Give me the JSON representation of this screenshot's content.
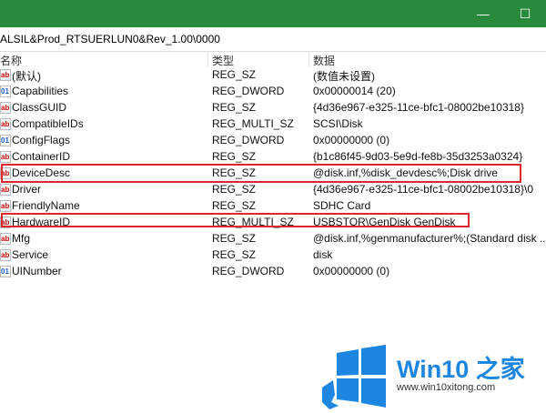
{
  "window": {
    "controls": {
      "minimize": "—",
      "maximize": "☐",
      "close": "✕"
    }
  },
  "path": "ALSIL&Prod_RTSUERLUN0&Rev_1.00\\0000",
  "columns": {
    "name": "名称",
    "type": "类型",
    "data": "数据"
  },
  "rows": [
    {
      "name": "(默认)",
      "type": "REG_SZ",
      "data": "(数值未设置)",
      "icon": "ab"
    },
    {
      "name": "Capabilities",
      "type": "REG_DWORD",
      "data": "0x00000014 (20)",
      "icon": "dw"
    },
    {
      "name": "ClassGUID",
      "type": "REG_SZ",
      "data": "{4d36e967-e325-11ce-bfc1-08002be10318}",
      "icon": "ab"
    },
    {
      "name": "CompatibleIDs",
      "type": "REG_MULTI_SZ",
      "data": "SCSI\\Disk",
      "icon": "ab"
    },
    {
      "name": "ConfigFlags",
      "type": "REG_DWORD",
      "data": "0x00000000 (0)",
      "icon": "dw"
    },
    {
      "name": "ContainerID",
      "type": "REG_SZ",
      "data": "{b1c86f45-9d03-5e9d-fe8b-35d3253a0324}",
      "icon": "ab"
    },
    {
      "name": "DeviceDesc",
      "type": "REG_SZ",
      "data": "@disk.inf,%disk_devdesc%;Disk drive",
      "icon": "ab"
    },
    {
      "name": "Driver",
      "type": "REG_SZ",
      "data": "{4d36e967-e325-11ce-bfc1-08002be10318}\\0",
      "icon": "ab"
    },
    {
      "name": "FriendlyName",
      "type": "REG_SZ",
      "data": "SDHC Card",
      "icon": "ab"
    },
    {
      "name": "HardwareID",
      "type": "REG_MULTI_SZ",
      "data": "USBSTOR\\GenDisk GenDisk",
      "icon": "ab"
    },
    {
      "name": "Mfg",
      "type": "REG_SZ",
      "data": "@disk.inf,%genmanufacturer%;(Standard disk ...",
      "icon": "ab"
    },
    {
      "name": "Service",
      "type": "REG_SZ",
      "data": "disk",
      "icon": "ab"
    },
    {
      "name": "UINumber",
      "type": "REG_DWORD",
      "data": "0x00000000 (0)",
      "icon": "dw"
    }
  ],
  "highlight_color": "#e0282c",
  "watermark": {
    "title": "Win10 之家",
    "url": "www.win10xitong.com"
  },
  "colors": {
    "titlebar": "#2a8a3c",
    "brand": "#1c86e0"
  }
}
